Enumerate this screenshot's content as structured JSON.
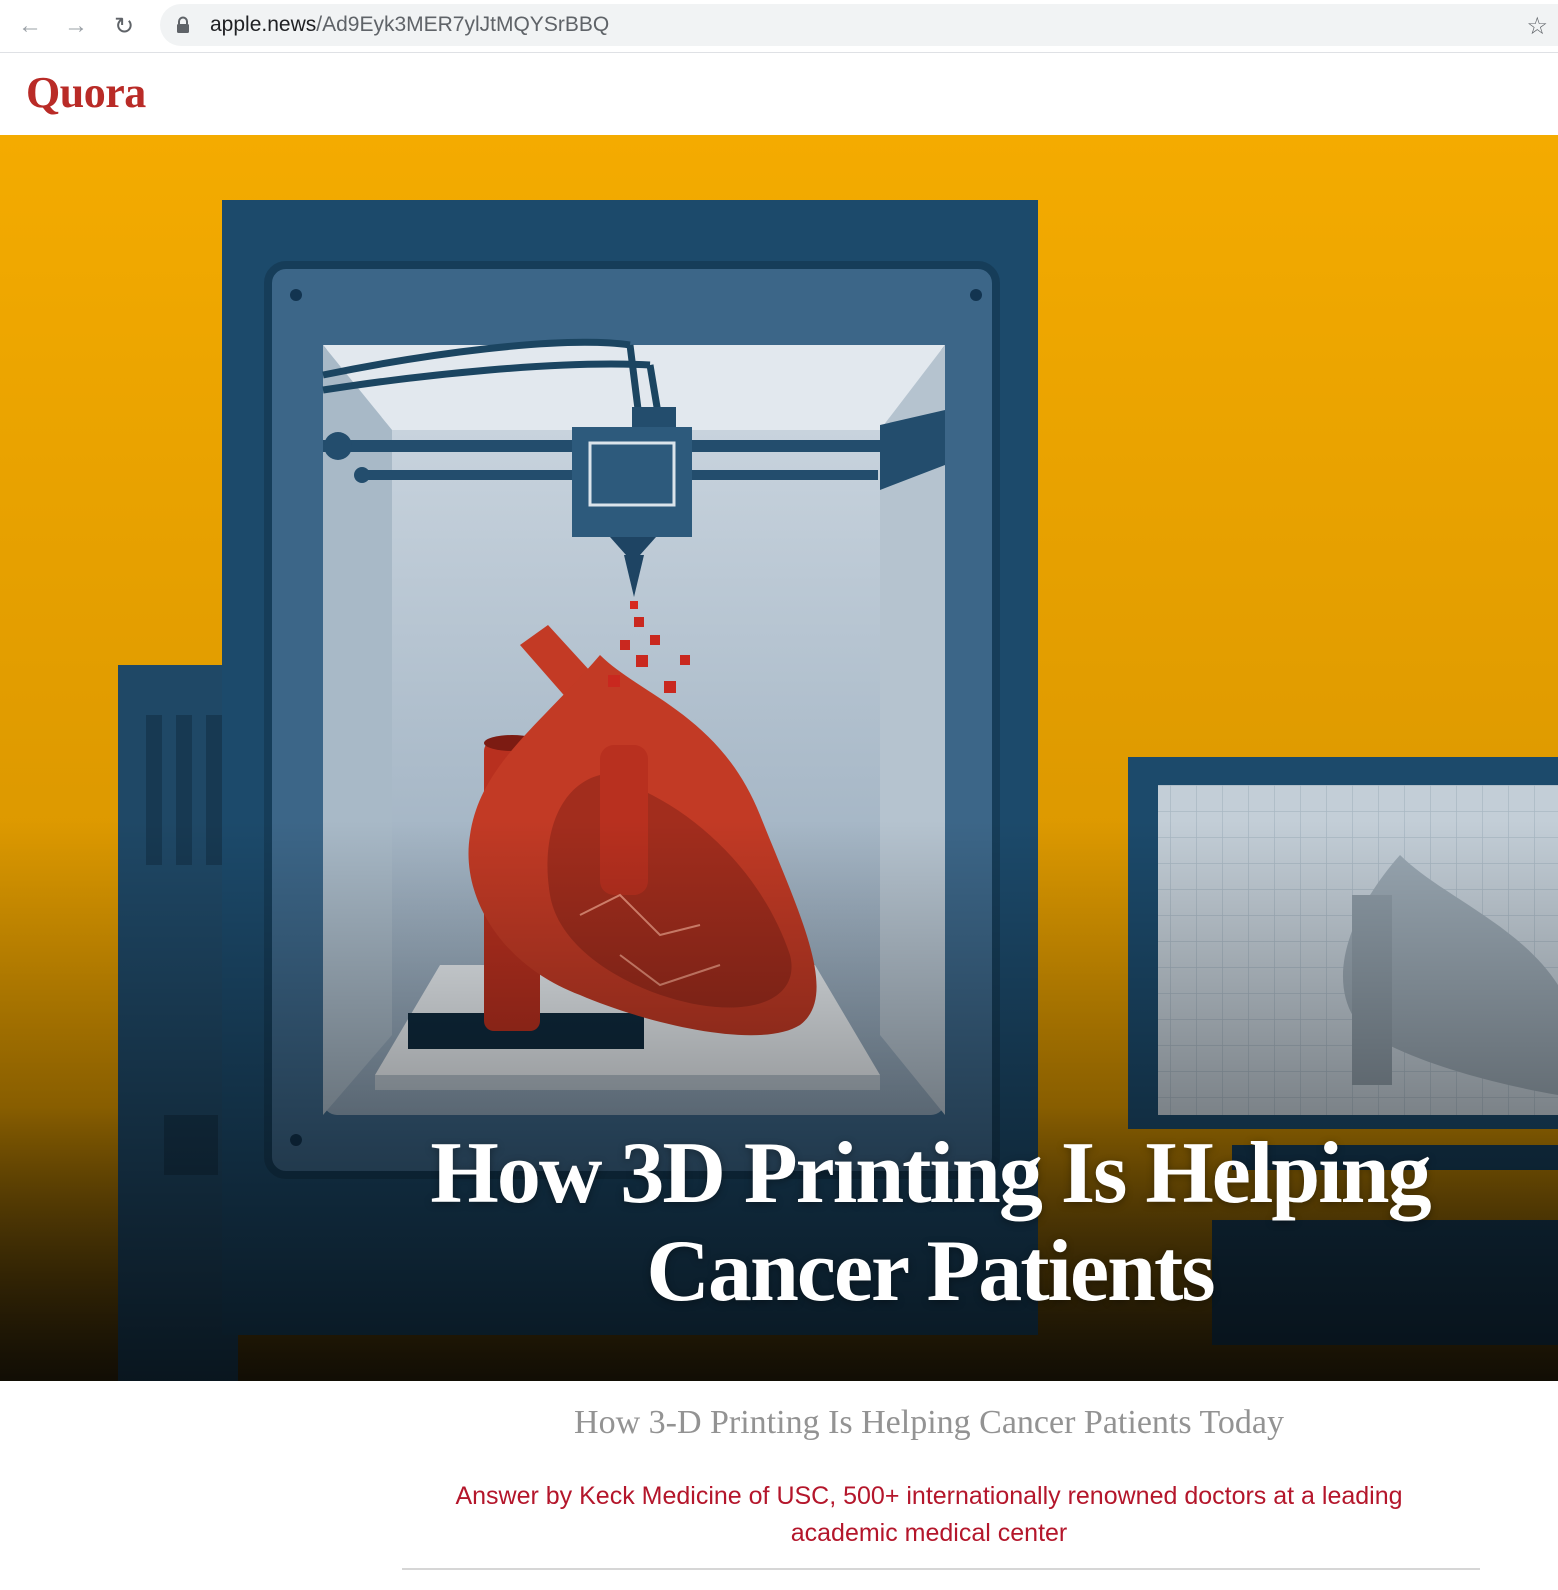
{
  "browser": {
    "url_host": "apple.news",
    "url_path": "/Ad9Eyk3MER7ylJtMQYSrBBQ",
    "icons": [
      "back-arrow-icon",
      "forward-arrow-icon",
      "reload-icon",
      "lock-icon",
      "star-icon"
    ]
  },
  "site": {
    "logo": "Quora",
    "brand_color": "#b92b27"
  },
  "hero": {
    "title_line1": "How 3D Printing Is Helping",
    "title_line2": "Cancer Patients",
    "background_color": "#f2a900"
  },
  "article": {
    "subtitle": "How 3-D Printing Is Helping Cancer Patients Today",
    "byline_line1": "Answer by Keck Medicine of USC, 500+ internationally renowned doctors at a leading",
    "byline_line2": "academic medical center",
    "byline_color": "#b4162b"
  }
}
